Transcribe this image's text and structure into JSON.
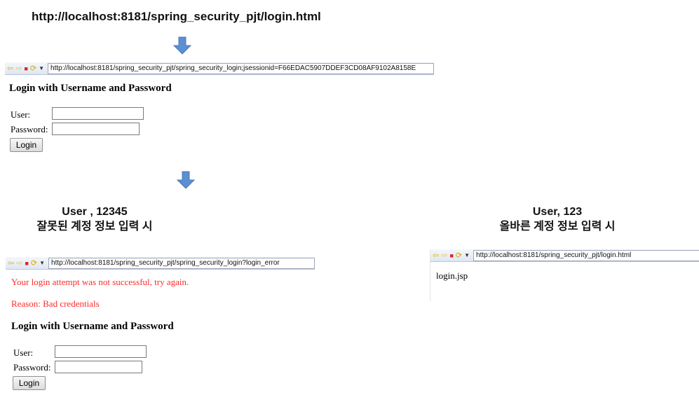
{
  "top_url": "http://localhost:8181/spring_security_pjt/login.html",
  "login_panel": {
    "address": "http://localhost:8181/spring_security_pjt/spring_security_login;jsessionid=F66EDAC5907DDEF3CD08AF9102A8158E",
    "heading": "Login with Username and Password",
    "user_label": "User:",
    "password_label": "Password:",
    "login_button": "Login"
  },
  "left_caption": {
    "line1": "User , 12345",
    "line2": "잘못된 계정 정보 입력 시"
  },
  "right_caption": {
    "line1": "User, 123",
    "line2": "올바른 계정 정보 입력 시"
  },
  "error_panel": {
    "address": "http://localhost:8181/spring_security_pjt/spring_security_login?login_error",
    "error_message": "Your login attempt was not successful, try again.",
    "reason": "Reason: Bad credentials",
    "heading": "Login with Username and Password",
    "user_label": "User:",
    "password_label": "Password:",
    "login_button": "Login"
  },
  "success_panel": {
    "address": "http://localhost:8181/spring_security_pjt/login.html",
    "content": "login.jsp"
  },
  "icons": [
    "back-icon",
    "forward-icon",
    "stop-icon",
    "refresh-icon",
    "dropdown-icon",
    "down-arrow-icon"
  ],
  "colors": {
    "arrow": "#5b8fd0",
    "error": "#ff2a2a"
  }
}
